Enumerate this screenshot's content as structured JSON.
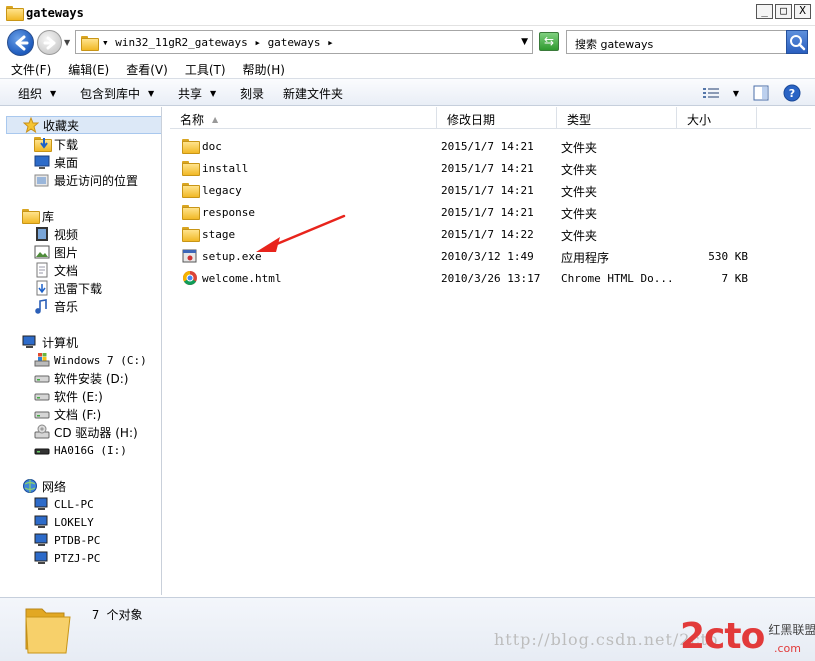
{
  "window": {
    "title": "gateways",
    "minimize": "_",
    "maximize": "□",
    "close": "X"
  },
  "address": {
    "path": "▾ win32_11gR2_gateways ▸ gateways ▸",
    "search_placeholder": "搜索 gateways"
  },
  "menu": [
    "文件(F)",
    "编辑(E)",
    "查看(V)",
    "工具(T)",
    "帮助(H)"
  ],
  "toolbar": {
    "organize": "组织",
    "include_in_library": "包含到库中",
    "share": "共享",
    "burn": "刻录",
    "new_folder": "新建文件夹"
  },
  "nav": {
    "favorites": {
      "label": "收藏夹",
      "items": [
        "下载",
        "桌面",
        "最近访问的位置"
      ]
    },
    "libraries": {
      "label": "库",
      "items": [
        "视频",
        "图片",
        "文档",
        "迅雷下载",
        "音乐"
      ]
    },
    "computer": {
      "label": "计算机",
      "items": [
        "Windows 7 (C:)",
        "软件安装 (D:)",
        "软件 (E:)",
        "文档 (F:)",
        "CD 驱动器 (H:)",
        "HA016G (I:)"
      ]
    },
    "network": {
      "label": "网络",
      "items": [
        "CLL-PC",
        "LOKELY",
        "PTDB-PC",
        "PTZJ-PC"
      ]
    }
  },
  "columns": {
    "name": "名称",
    "date": "修改日期",
    "type": "类型",
    "size": "大小"
  },
  "files": [
    {
      "name": "doc",
      "date": "2015/1/7 14:21",
      "type": "文件夹",
      "size": "",
      "icon": "folder-icon"
    },
    {
      "name": "install",
      "date": "2015/1/7 14:21",
      "type": "文件夹",
      "size": "",
      "icon": "folder-icon"
    },
    {
      "name": "legacy",
      "date": "2015/1/7 14:21",
      "type": "文件夹",
      "size": "",
      "icon": "folder-icon"
    },
    {
      "name": "response",
      "date": "2015/1/7 14:21",
      "type": "文件夹",
      "size": "",
      "icon": "folder-icon"
    },
    {
      "name": "stage",
      "date": "2015/1/7 14:22",
      "type": "文件夹",
      "size": "",
      "icon": "folder-icon"
    },
    {
      "name": "setup.exe",
      "date": "2010/3/12 1:49",
      "type": "应用程序",
      "size": "530 KB",
      "icon": "exe-icon"
    },
    {
      "name": "welcome.html",
      "date": "2010/3/26 13:17",
      "type": "Chrome HTML Do...",
      "size": "7 KB",
      "icon": "chrome-icon"
    }
  ],
  "status": {
    "count": "7 个对象"
  },
  "watermark": {
    "url": "http://blog.csdn.net/2cto",
    "logo": "2cto",
    "logo_sub": "红黑联盟",
    "logo_domain": ".com"
  },
  "colors": {
    "arrow": "#e8241c",
    "folder": "#f1b826",
    "accent": "#1e5bbd"
  }
}
